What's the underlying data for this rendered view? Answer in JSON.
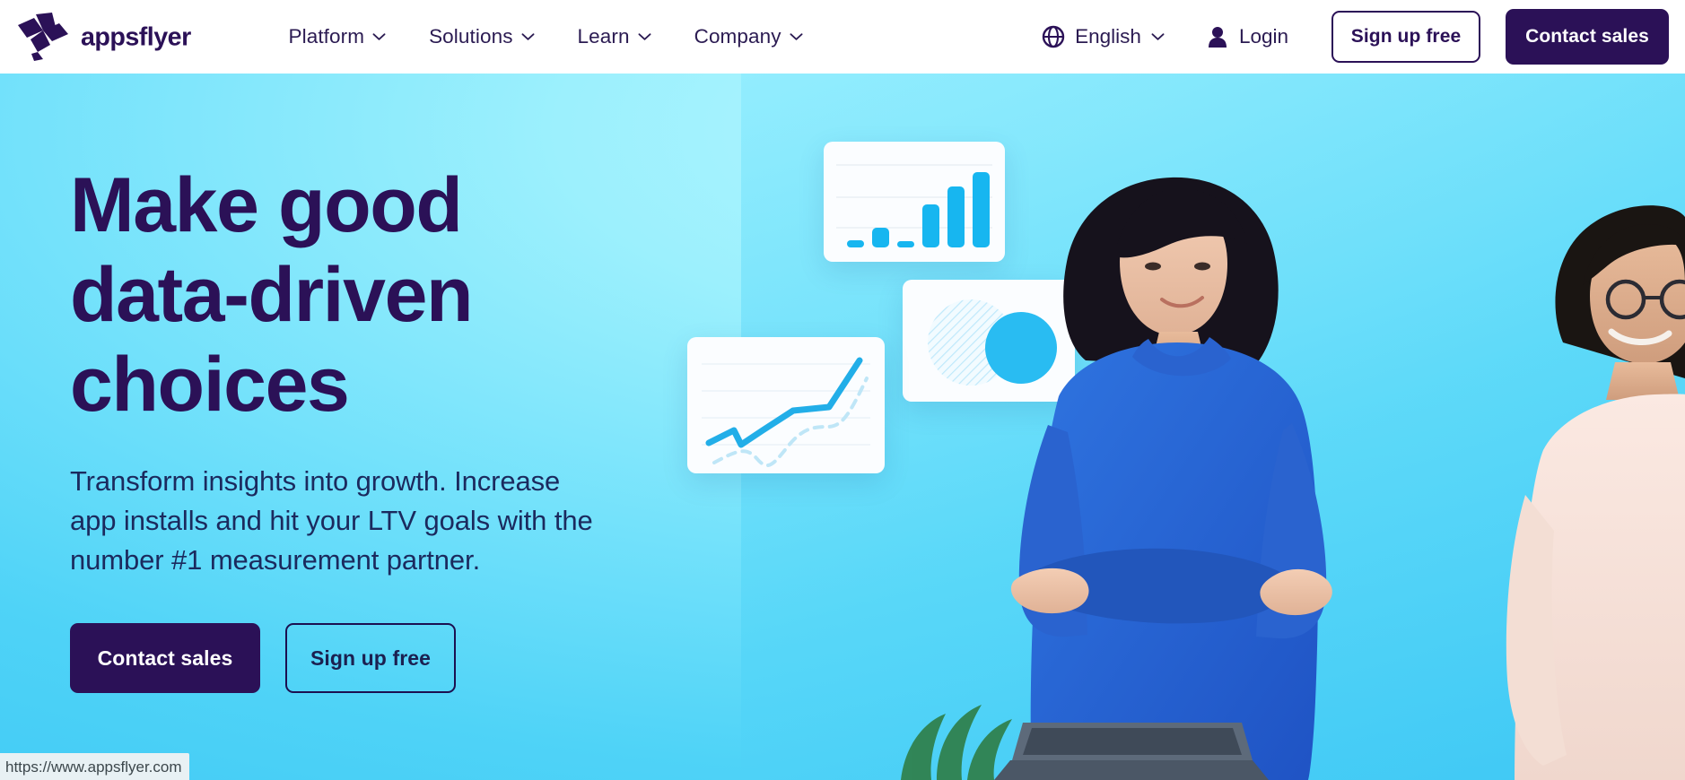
{
  "navbar": {
    "logo": {
      "icon": "appsflyer-logo-icon",
      "text": "appsflyer"
    },
    "links": [
      {
        "label": "Platform",
        "icon": "chevron-down-icon"
      },
      {
        "label": "Solutions",
        "icon": "chevron-down-icon"
      },
      {
        "label": "Learn",
        "icon": "chevron-down-icon"
      },
      {
        "label": "Company",
        "icon": "chevron-down-icon"
      }
    ],
    "language": {
      "label": "English",
      "icon": "globe-icon",
      "caret": "chevron-down-icon"
    },
    "login": {
      "label": "Login",
      "icon": "user-icon"
    },
    "signup_label": "Sign up free",
    "contact_label": "Contact sales"
  },
  "hero": {
    "title_line1": "Make good",
    "title_line2": "data-driven",
    "title_line3": "choices",
    "subtitle": "Transform insights into growth. Increase app installs and hit your LTV goals with the number #1 measurement partner.",
    "primary_cta": "Contact sales",
    "secondary_cta": "Sign up free"
  },
  "illustration": {
    "bar_card": {
      "name": "bar-chart-card",
      "values": [
        8,
        22,
        7,
        52,
        78,
        100
      ]
    },
    "pie_card": {
      "name": "circles-card"
    },
    "line_card": {
      "name": "line-chart-card"
    }
  },
  "status_bar": {
    "url": "https://www.appsflyer.com"
  },
  "colors": {
    "brand_purple": "#2b1157",
    "accent_cyan": "#17b6f0",
    "hero_bg_light": "#9cf0fd",
    "hero_bg_deep": "#3fc9f5",
    "text_navy": "#1b2a5e"
  }
}
